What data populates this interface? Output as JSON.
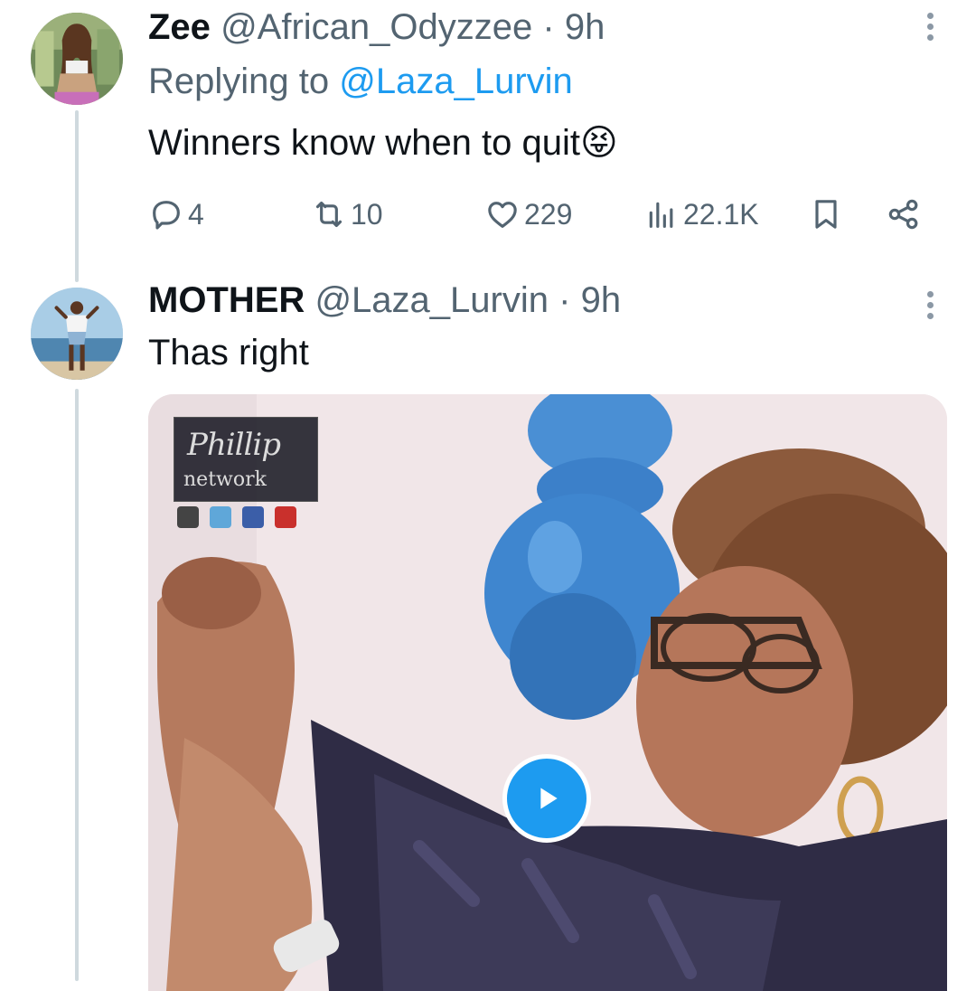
{
  "tweets": [
    {
      "display_name": "Zee",
      "handle": "@African_Odyzzee",
      "separator": "·",
      "time": "9h",
      "replying_prefix": "Replying to",
      "replying_to": "@Laza_Lurvin",
      "text": "Winners know when to quit",
      "emoji": "😝",
      "stats": {
        "replies": "4",
        "retweets": "10",
        "likes": "229",
        "views": "22.1K"
      },
      "icons": [
        "reply-icon",
        "retweet-icon",
        "like-icon",
        "views-icon",
        "bookmark-icon",
        "share-icon",
        "more-icon"
      ]
    },
    {
      "display_name": "MOTHER",
      "handle": "@Laza_Lurvin",
      "separator": "·",
      "time": "9h",
      "text": "Thas right",
      "media": {
        "watermark_script": "Phillip",
        "watermark_sub": "network",
        "play_icon": "play-icon"
      }
    }
  ],
  "colors": {
    "accent": "#1d9bf0",
    "muted": "#536471",
    "text": "#0f1419",
    "thread_line": "#cfd9de"
  }
}
